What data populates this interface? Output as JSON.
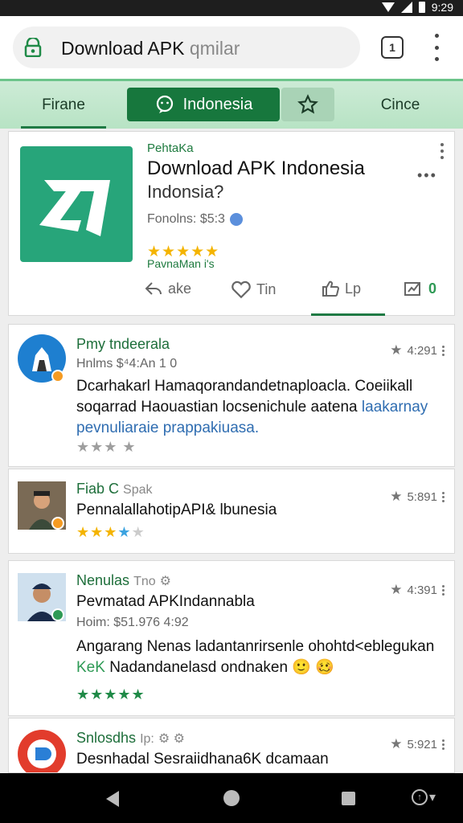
{
  "status_bar": {
    "time": "9:29"
  },
  "browser": {
    "url_text": "Download APK",
    "url_suffix": "qmilar",
    "tab_count": "1"
  },
  "tabs": [
    {
      "label": "Firane"
    },
    {
      "label": "Indonesia"
    },
    {
      "label": ""
    },
    {
      "label": "Cince"
    }
  ],
  "app": {
    "publisher": "PehtaKa",
    "title": "Download APK Indonesia",
    "subtitle": "Indonsia?",
    "price": "Fonolns: $5:3",
    "stars": "★★★★★",
    "rating_label": "PavnaMan i's",
    "actions": [
      {
        "label": "ake"
      },
      {
        "label": "Tin"
      },
      {
        "label": "Lp"
      },
      {
        "label": "0"
      }
    ]
  },
  "reviews": [
    {
      "name": "Pmy tndeerala",
      "name_suffix": "",
      "meta": "Hnlms $⁴4:An 1 0",
      "text": "Dcarhakarl Hamaqorandandetnaploacla. Coeiikall soqarrad Haouastian locsenichule aatena",
      "text_blue": "laakarnay pevnuliaraie prappakiuasa.",
      "stars": "★★★ ★",
      "score": "4:291"
    },
    {
      "name": "Fiab C",
      "name_suffix": "Spak",
      "meta": "",
      "text": "PennalallahotipAPI& lbunesia",
      "text_blue": "",
      "stars": "★★★★★",
      "score": "5:891"
    },
    {
      "name": "Nenulas",
      "name_suffix": "Tno",
      "meta": "Hoim: $51.976 4:92",
      "title_line": "Pevmatad APKIndannabla",
      "text": "Angarang Nenas ladantanrirsenle ohohtd<eblegukan",
      "text_line2_prefix": "KeK",
      "text_line2": "Nadandanelasd ondnaken 🙂 🥴",
      "stars": "★★★★★",
      "score": "4:391"
    },
    {
      "name": "Snlosdhs",
      "name_suffix": "Ip:",
      "meta": "",
      "text": "Desnhadal Sesraiidhana6K dcamaan",
      "text_blue": "",
      "stars": "",
      "score": "5:921"
    }
  ],
  "colors": {
    "accent_green": "#17773d",
    "app_icon": "#27a57a",
    "star_gold": "#f4b400"
  }
}
